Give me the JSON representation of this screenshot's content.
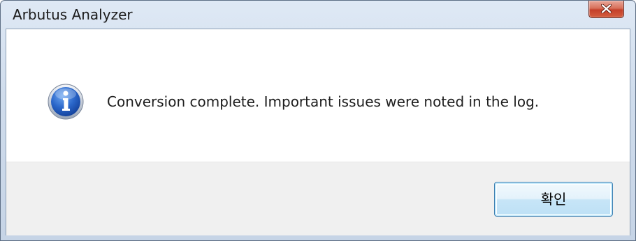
{
  "window": {
    "title": "Arbutus Analyzer",
    "close_icon": "close-icon"
  },
  "dialog": {
    "icon": "info-icon",
    "message": "Conversion complete. Important issues were noted in the log."
  },
  "buttons": {
    "ok_label": "확인"
  },
  "colors": {
    "frame": "#cfdcec",
    "close_red": "#c4402a",
    "info_blue": "#1b55b8",
    "button_border": "#3c7fb1",
    "footer": "#f0f0f0"
  }
}
